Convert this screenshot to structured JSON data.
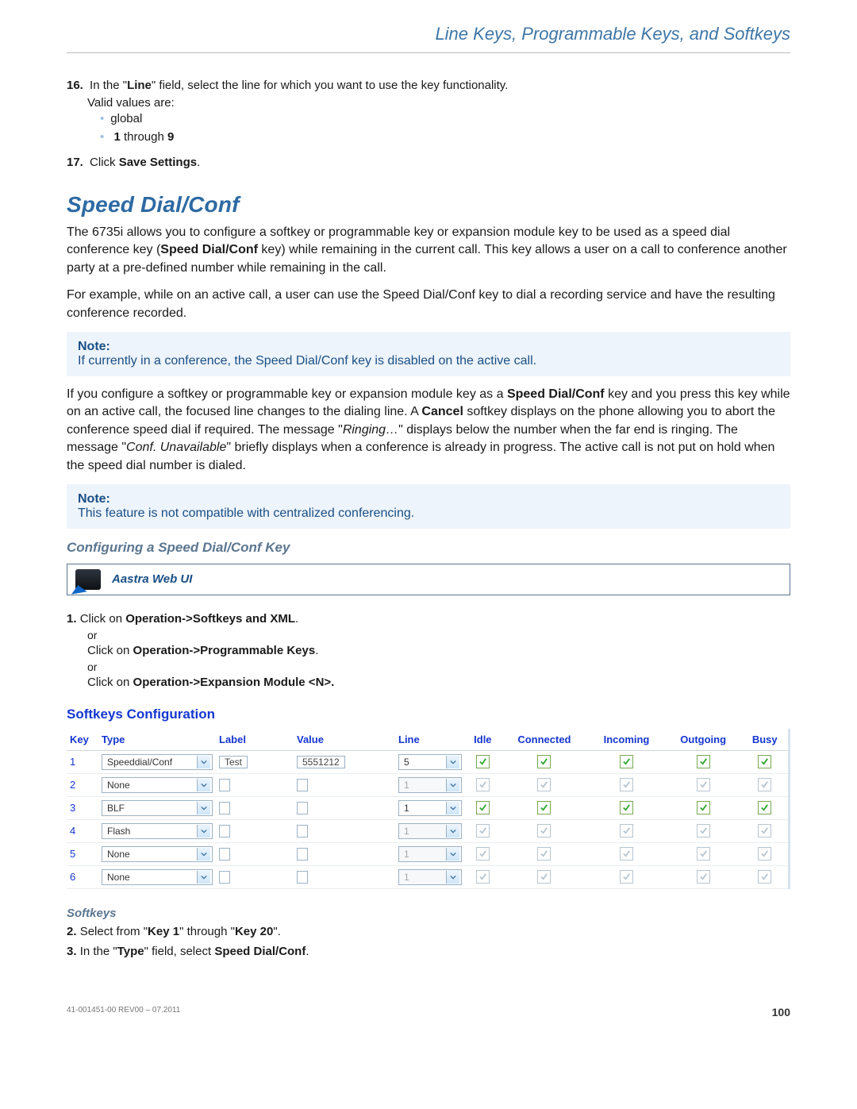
{
  "header": {
    "title": "Line Keys, Programmable Keys, and Softkeys"
  },
  "intro_steps": {
    "s16_num": "16.",
    "s16_text": "In the \"Line\" field, select the line for which you want to use the key functionality.",
    "valid": "Valid values are:",
    "b1": "global",
    "b2_pre": "1",
    "b2_mid": " through ",
    "b2_post": "9",
    "s17_num": "17.",
    "s17_text": "Click ",
    "s17_bold": "Save Settings",
    "s17_dot": "."
  },
  "section_title": "Speed Dial/Conf",
  "p1_a": "The 6735i allows you to configure a softkey or programmable key or expansion module key to be used as a speed dial conference key (",
  "p1_b": "Speed Dial/Conf",
  "p1_c": " key) while remaining in the current call. This key allows a user on a call to conference another party at a pre-defined number while remaining in the call.",
  "p2": "For example, while on an active call, a user can use the Speed Dial/Conf key to dial a recording service and have the resulting conference recorded.",
  "note1_h": "Note:",
  "note1_t": "If currently in a conference, the Speed Dial/Conf key is disabled on the active call.",
  "p3_a": "If you configure a softkey or programmable key or expansion module key as a ",
  "p3_b": "Speed Dial/Conf",
  "p3_c": " key and you press this key while on an active call, the focused line changes to the dialing line. A ",
  "p3_d": "Cancel",
  "p3_e": " softkey displays on the phone allowing you to abort the conference speed dial if required. The message \"",
  "p3_f": "Ringing…",
  "p3_g": "\" displays below the number when the far end is ringing. The message \"",
  "p3_h": "Conf. Unavailable",
  "p3_i": "\" briefly displays when a conference is already in progress. The active call is not put on hold when the speed dial number is dialed.",
  "note2_h": "Note:",
  "note2_t": "This feature is not compatible with centralized conferencing.",
  "sub_title": "Configuring a Speed Dial/Conf Key",
  "webui": "Aastra Web UI",
  "steps2": {
    "n1": "1.",
    "t1a": "Click on ",
    "t1b": "Operation->Softkeys and XML",
    "t1c": ".",
    "or": "or",
    "t2a": "Click on ",
    "t2b": "Operation->Programmable Keys",
    "t2c": ".",
    "t3a": "Click on ",
    "t3b": "Operation->Expansion Module <N>.",
    "t3c": ""
  },
  "sk_config_title": "Softkeys Configuration",
  "sk": {
    "headers": {
      "key": "Key",
      "type": "Type",
      "label": "Label",
      "value": "Value",
      "line": "Line",
      "idle": "Idle",
      "connected": "Connected",
      "incoming": "Incoming",
      "outgoing": "Outgoing",
      "busy": "Busy"
    },
    "rows": [
      {
        "key": "1",
        "type": "Speeddial/Conf",
        "type_disabled": false,
        "label": "Test",
        "value": "5551212",
        "line": "5",
        "line_disabled": false,
        "states": true
      },
      {
        "key": "2",
        "type": "None",
        "type_disabled": false,
        "label": "",
        "value": "",
        "line": "1",
        "line_disabled": true,
        "states": false
      },
      {
        "key": "3",
        "type": "BLF",
        "type_disabled": false,
        "label": "",
        "value": "",
        "line": "1",
        "line_disabled": false,
        "states": true
      },
      {
        "key": "4",
        "type": "Flash",
        "type_disabled": false,
        "label": "",
        "value": "",
        "line": "1",
        "line_disabled": true,
        "states": false
      },
      {
        "key": "5",
        "type": "None",
        "type_disabled": false,
        "label": "",
        "value": "",
        "line": "1",
        "line_disabled": true,
        "states": false
      },
      {
        "key": "6",
        "type": "None",
        "type_disabled": false,
        "label": "",
        "value": "",
        "line": "1",
        "line_disabled": true,
        "states": false
      }
    ]
  },
  "softkeys_h": "Softkeys",
  "steps3": {
    "n2": "2.",
    "t2a": "Select from \"",
    "t2b": "Key 1",
    "t2c": "\" through \"",
    "t2d": "Key 20",
    "t2e": "\".",
    "n3": "3.",
    "t3a": "In the \"",
    "t3b": "Type",
    "t3c": "\" field, select ",
    "t3d": "Speed Dial/Conf",
    "t3e": "."
  },
  "footer": {
    "left": "41-001451-00 REV00 – 07.2011",
    "right": "100"
  }
}
